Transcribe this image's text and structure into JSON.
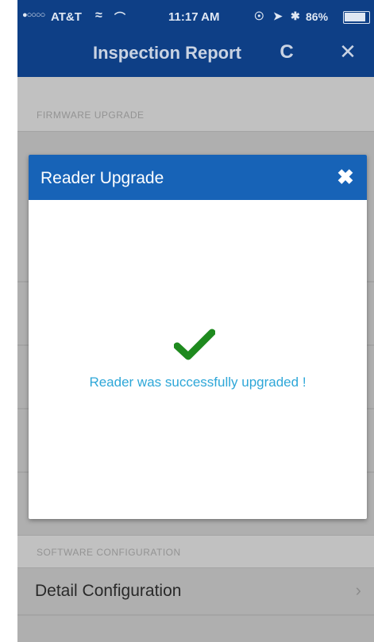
{
  "status_bar": {
    "signal": "●○○○○",
    "carrier": "AT&T",
    "wifi_icon": "wifi-icon",
    "loading_icon": "activity-icon",
    "time": "11:17 AM",
    "battery_percent": "86%"
  },
  "nav": {
    "title": "Inspection Report",
    "refresh_glyph": "C",
    "close_glyph": "✕"
  },
  "sections": [
    {
      "header": "FIRMWARE UPGRADE"
    },
    {
      "header": "SOFTWARE CONFIGURATION",
      "row_label": "Detail Configuration"
    }
  ],
  "modal": {
    "title": "Reader Upgrade",
    "close_glyph": "✖",
    "message": "Reader was successfully upgraded !"
  },
  "colors": {
    "nav_bar": "#0e3f86",
    "modal_header": "#1763b7",
    "success_check": "#1e8a1e",
    "message_text": "#2ea7d8"
  }
}
